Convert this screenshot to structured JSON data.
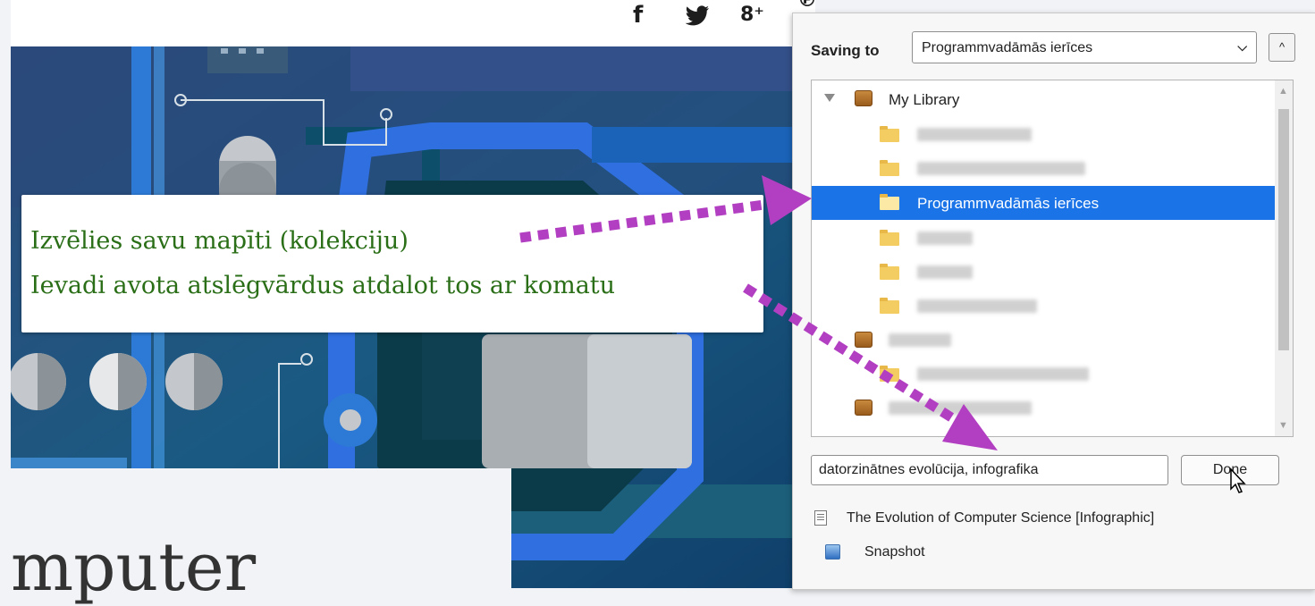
{
  "social": {
    "facebook_glyph": "f",
    "twitter_glyph": "t",
    "googleplus_glyph": "g+",
    "pinterest_glyph": "p"
  },
  "article": {
    "title_fragment": "mputer"
  },
  "callout": {
    "line1": "Izvēlies savu mapīti (kolekciju)",
    "line2": "Ievadi avota atslēgvārdus atdalot tos ar komatu",
    "text_color": "#2a6e17",
    "arrow_color": "#b23fc1"
  },
  "popup": {
    "saving_label": "Saving to",
    "selected_collection": "Programmvadāmās ierīces",
    "collapse_glyph": "^",
    "tree": {
      "library_label": "My Library",
      "selected_label": "Programmvadāmās ierīces"
    },
    "tags_value": "datorzinātnes evolūcija, infografika",
    "done_label": "Done",
    "items": [
      {
        "label": "The Evolution of Computer Science [Infographic]",
        "icon": "document-icon"
      },
      {
        "label": "Snapshot",
        "icon": "snapshot-icon"
      }
    ],
    "accent_color": "#1a74e8"
  }
}
